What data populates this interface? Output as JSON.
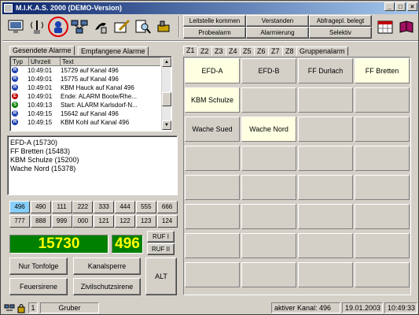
{
  "window": {
    "title": "M.I.K.A.S. 2000 (DEMO-Version)"
  },
  "toolbar": {
    "tools": [
      {
        "icon": "monitor-icon"
      },
      {
        "icon": "radio-tower-icon"
      },
      {
        "icon": "person-icon"
      },
      {
        "icon": "network-icon"
      },
      {
        "icon": "phone-icon"
      },
      {
        "icon": "edit-icon"
      },
      {
        "icon": "search-icon"
      },
      {
        "icon": "tools-icon"
      }
    ],
    "commands": [
      "Leitstelle kommen",
      "Verstanden",
      "Abfragepl. belegt",
      "Probealarm",
      "Alarmierung",
      "Selektiv"
    ]
  },
  "left_tabs": [
    "Gesendete Alarme",
    "Empfangene Alarme"
  ],
  "alarm_table": {
    "headers": [
      "Typ",
      "Uhrzeit",
      "Text"
    ],
    "rows": [
      {
        "type": "blue",
        "time": "10:49:01",
        "text": "15729 auf Kanal 496"
      },
      {
        "type": "blue",
        "time": "10:49:01",
        "text": "15775 auf Kanal 496"
      },
      {
        "type": "blue",
        "time": "10:49:01",
        "text": "KBM Hauck auf Kanal 496"
      },
      {
        "type": "red",
        "time": "10:49:01",
        "text": "Ende: ALARM Boote/Rhe..."
      },
      {
        "type": "green",
        "time": "10:49:13",
        "text": "Start: ALARM Karlsdorf-N..."
      },
      {
        "type": "blue",
        "time": "10:49:15",
        "text": "15642 auf Kanal 496"
      },
      {
        "type": "blue",
        "time": "10:49:15",
        "text": "KBM Kohl auf Kanal 496"
      }
    ]
  },
  "selected_units": [
    "EFD-A (15730)",
    "FF Bretten (15483)",
    "KBM Schulze (15200)",
    "Wache Nord (15378)"
  ],
  "channels": {
    "row1": [
      "496",
      "490",
      "111",
      "222",
      "333",
      "444",
      "555",
      "666"
    ],
    "row2": [
      "777",
      "888",
      "999",
      "000",
      "121",
      "122",
      "123",
      "124"
    ],
    "active": "496"
  },
  "display": {
    "code": "15730",
    "channel": "496"
  },
  "ruf_buttons": [
    "RUF I",
    "RUF II"
  ],
  "action_buttons": [
    "Nur Tonfolge",
    "Kanalsperre",
    "Feuersirene",
    "Zivilschutzsirene"
  ],
  "alt_button": "ALT",
  "right_tabs": [
    "Z1",
    "Z2",
    "Z3",
    "Z4",
    "Z5",
    "Z6",
    "Z7",
    "Z8",
    "Gruppenalarm"
  ],
  "grid": {
    "cells": [
      {
        "label": "EFD-A",
        "active": true
      },
      {
        "label": "EFD-B",
        "active": false
      },
      {
        "label": "FF Durlach",
        "active": false
      },
      {
        "label": "FF Bretten",
        "active": true
      },
      {
        "label": "KBM Schulze",
        "active": true
      },
      {
        "label": "",
        "active": false
      },
      {
        "label": "",
        "active": false
      },
      {
        "label": "",
        "active": false
      },
      {
        "label": "Wache Sued",
        "active": false
      },
      {
        "label": "Wache Nord",
        "active": true
      }
    ]
  },
  "statusbar": {
    "user": "Gruber",
    "page": "1",
    "channel": "aktiver Kanal: 496",
    "date": "19.01.2003",
    "time": "10:49:33"
  },
  "colors": {
    "display_bg": "#008000",
    "display_fg": "#ffff00",
    "active_channel": "#87cefa",
    "selected_cell": "#ffffe1"
  }
}
